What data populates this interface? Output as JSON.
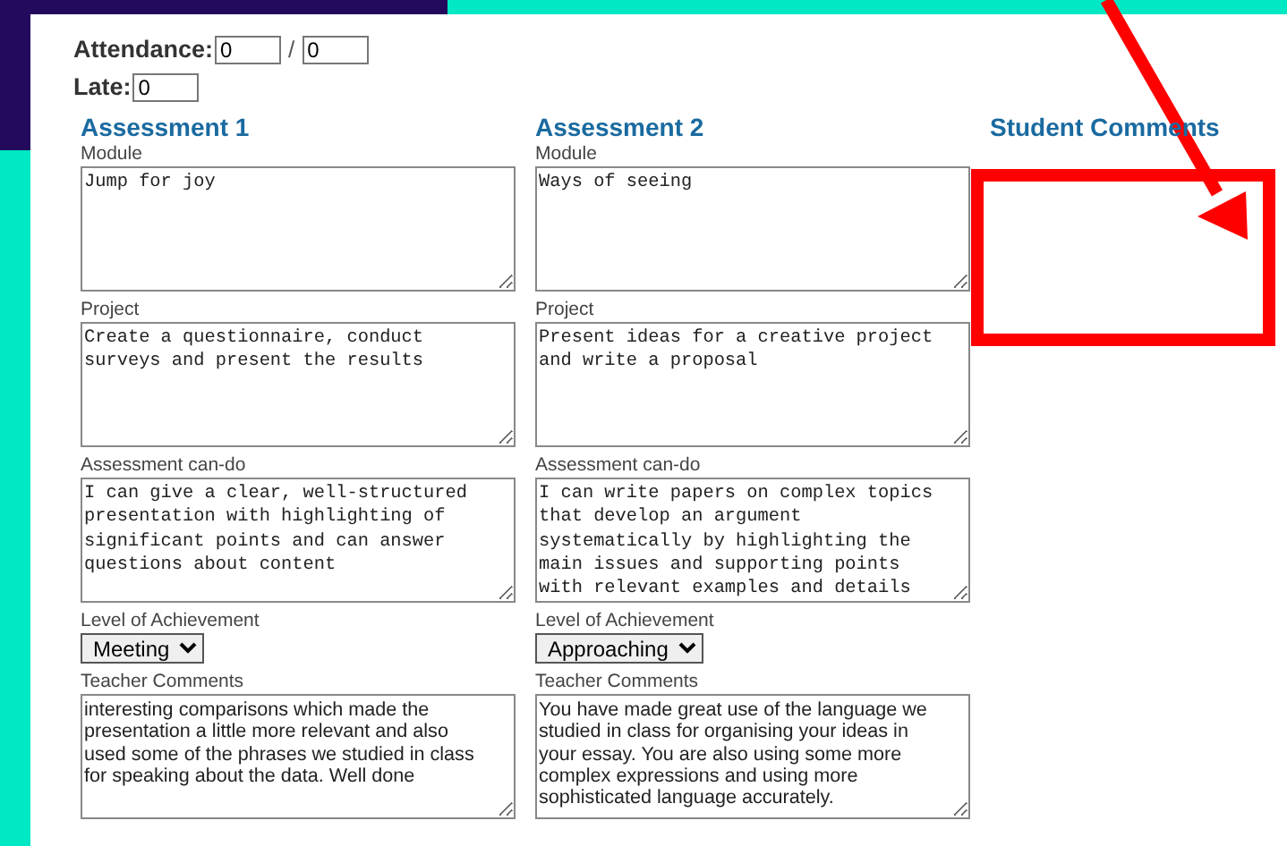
{
  "attendance": {
    "label": "Attendance:",
    "attended": "0",
    "separator": "/",
    "total": "0"
  },
  "late": {
    "label": "Late:",
    "value": "0"
  },
  "assessments": [
    {
      "title": "Assessment 1",
      "fields": [
        {
          "label": "Module",
          "kind": "text",
          "value": "Jump for joy"
        },
        {
          "label": "Project",
          "kind": "text",
          "value": "Create a questionnaire, conduct surveys and present the results"
        },
        {
          "label": "Assessment can-do",
          "kind": "text",
          "value": "I can give a clear, well-structured presentation with highlighting of significant points and can answer questions about content"
        },
        {
          "label": "Level of Achievement",
          "kind": "select",
          "value": "Meeting"
        },
        {
          "label": "Teacher Comments",
          "kind": "comment",
          "value": "interesting comparisons which made the presentation a little more relevant and also used some of the phrases we studied in class for speaking about the data. Well done"
        }
      ]
    },
    {
      "title": "Assessment 2",
      "fields": [
        {
          "label": "Module",
          "kind": "text",
          "value": "Ways of seeing"
        },
        {
          "label": "Project",
          "kind": "text",
          "value": "Present ideas for a creative project and write a proposal"
        },
        {
          "label": "Assessment can-do",
          "kind": "text",
          "value": "I can write papers on complex topics that develop an argument systematically by highlighting the main issues and supporting points with relevant examples and details"
        },
        {
          "label": "Level of Achievement",
          "kind": "select",
          "value": "Approaching"
        },
        {
          "label": "Teacher Comments",
          "kind": "comment",
          "value": "You have made great use of the language we  studied in class for organising your ideas in your essay. You are also using some more complex expressions and using more sophisticated language accurately."
        }
      ]
    }
  ],
  "student_comments": {
    "title": "Student Comments"
  }
}
